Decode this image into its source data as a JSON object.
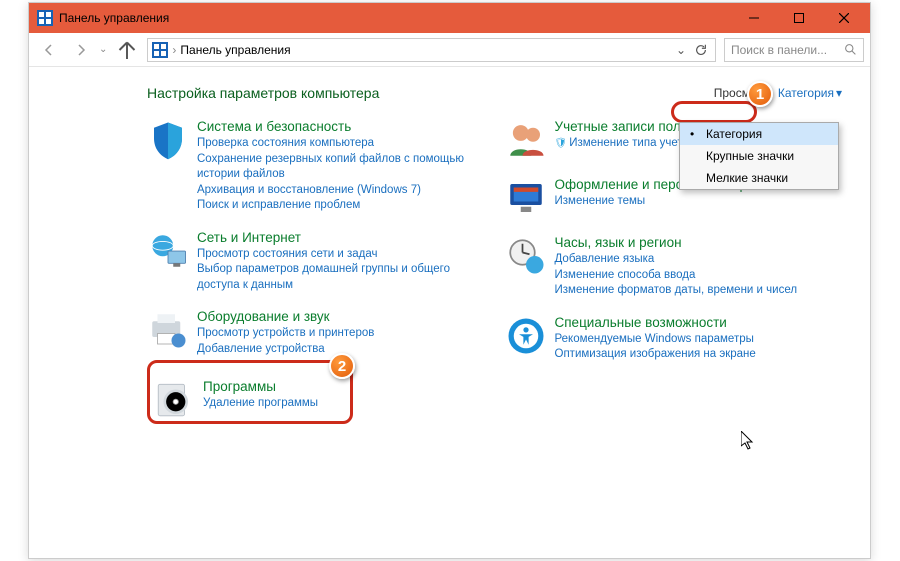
{
  "titlebar": {
    "title": "Панель управления"
  },
  "nav": {
    "breadcrumb": "Панель управления",
    "search_placeholder": "Поиск в панели..."
  },
  "heading": "Настройка параметров компьютера",
  "view": {
    "label": "Просмотр:",
    "current": "Категория"
  },
  "menu": {
    "items": [
      "Категория",
      "Крупные значки",
      "Мелкие значки"
    ]
  },
  "left": [
    {
      "title": "Система и безопасность",
      "links": [
        "Проверка состояния компьютера",
        "Сохранение резервных копий файлов с помощью истории файлов",
        "Архивация и восстановление (Windows 7)",
        "Поиск и исправление проблем"
      ]
    },
    {
      "title": "Сеть и Интернет",
      "links": [
        "Просмотр состояния сети и задач",
        "Выбор параметров домашней группы и общего доступа к данным"
      ]
    },
    {
      "title": "Оборудование и звук",
      "links": [
        "Просмотр устройств и принтеров",
        "Добавление устройства"
      ]
    },
    {
      "title": "Программы",
      "links": [
        "Удаление программы"
      ]
    }
  ],
  "right": [
    {
      "title": "Учетные записи пользователей",
      "links": [
        "Изменение типа учетной записи"
      ],
      "shield": true
    },
    {
      "title": "Оформление и персонализация",
      "links": [
        "Изменение темы"
      ]
    },
    {
      "title": "Часы, язык и регион",
      "links": [
        "Добавление языка",
        "Изменение способа ввода",
        "Изменение форматов даты, времени и чисел"
      ]
    },
    {
      "title": "Специальные возможности",
      "links": [
        "Рекомендуемые Windows параметры",
        "Оптимизация изображения на экране"
      ]
    }
  ],
  "badges": {
    "b1": "1",
    "b2": "2"
  }
}
